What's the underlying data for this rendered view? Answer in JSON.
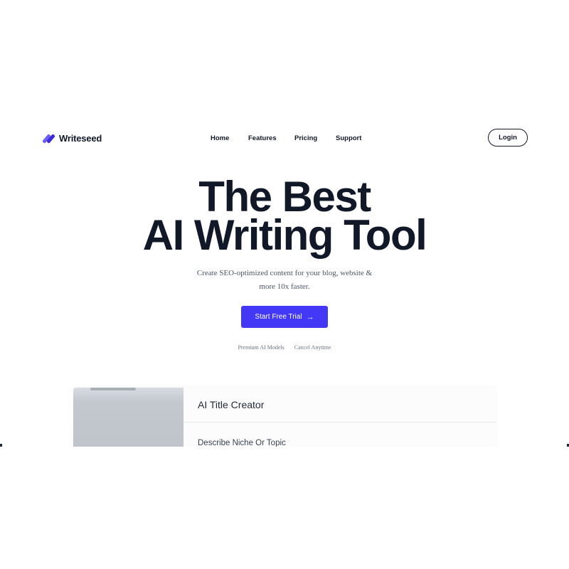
{
  "brand": {
    "name": "Writeseed",
    "accent": "#4338f5"
  },
  "nav": {
    "items": [
      {
        "label": "Home"
      },
      {
        "label": "Features"
      },
      {
        "label": "Pricing"
      },
      {
        "label": "Support"
      }
    ],
    "login_label": "Login"
  },
  "hero": {
    "title_line1": "The Best",
    "title_line2": "AI Writing Tool",
    "subtitle_line1": "Create SEO-optimized content for your blog, website &",
    "subtitle_line2": "more 10x faster.",
    "cta_label": "Start Free Trial",
    "cta_icon": "arrow-right-icon",
    "features": [
      "Premium AI Models",
      "Cancel Anytime"
    ]
  },
  "preview": {
    "title": "AI Title Creator",
    "field_label": "Describe Niche Or Topic"
  }
}
